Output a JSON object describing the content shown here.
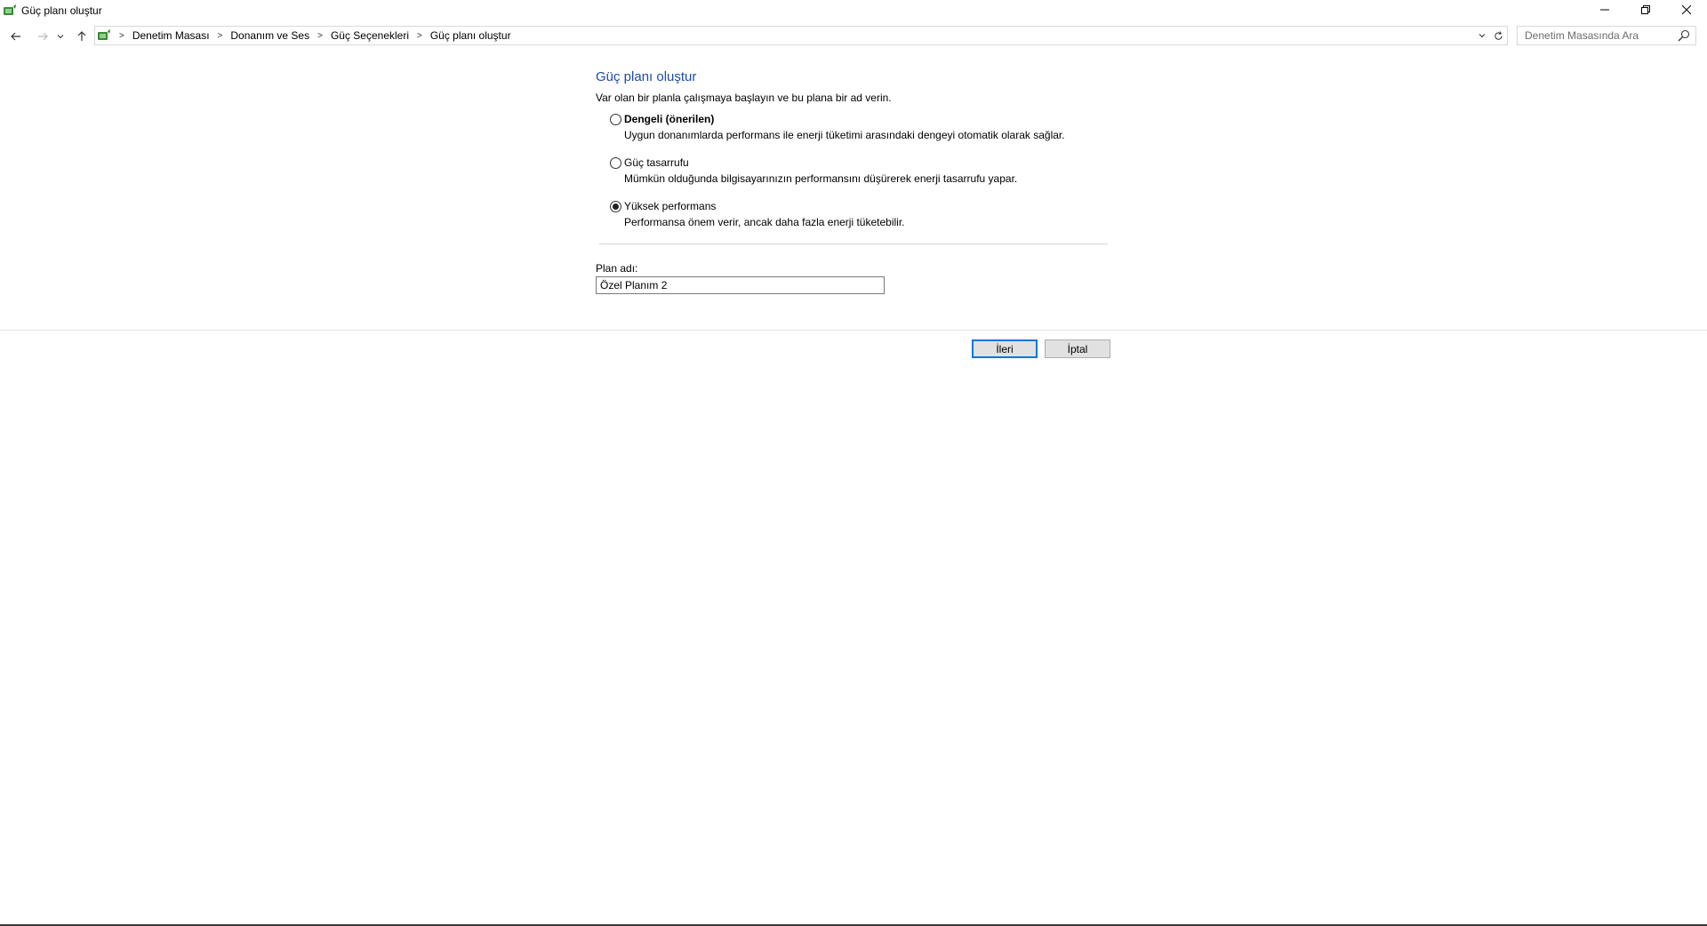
{
  "window": {
    "title": "Güç planı oluştur",
    "controls": {
      "minimize": "—",
      "restore": "❐",
      "close": "✕"
    }
  },
  "nav": {
    "back_icon": "arrow-left-icon",
    "forward_icon": "arrow-right-icon",
    "recent_icon": "chevron-down-icon",
    "up_icon": "arrow-up-icon",
    "breadcrumbs": [
      "Denetim Masası",
      "Donanım ve Ses",
      "Güç Seçenekleri",
      "Güç planı oluştur"
    ],
    "search_placeholder": "Denetim Masasında Ara"
  },
  "main": {
    "title": "Güç planı oluştur",
    "intro": "Var olan bir planla çalışmaya başlayın ve bu plana bir ad verin.",
    "options": [
      {
        "label": "Dengeli (önerilen)",
        "description": "Uygun donanımlarda performans ile enerji tüketimi arasındaki dengeyi otomatik olarak sağlar.",
        "checked": false
      },
      {
        "label": "Güç tasarrufu",
        "description": "Mümkün olduğunda bilgisayarınızın performansını düşürerek enerji tasarrufu yapar.",
        "checked": false
      },
      {
        "label": "Yüksek performans",
        "description": "Performansa önem verir, ancak daha fazla enerji tüketebilir.",
        "checked": true
      }
    ],
    "plan_name_label": "Plan adı:",
    "plan_name_value": "Özel Planım 2"
  },
  "buttons": {
    "next": "İleri",
    "cancel": "İptal"
  },
  "colors": {
    "title_blue": "#1c4ea7",
    "primary_border": "#0078d7"
  }
}
